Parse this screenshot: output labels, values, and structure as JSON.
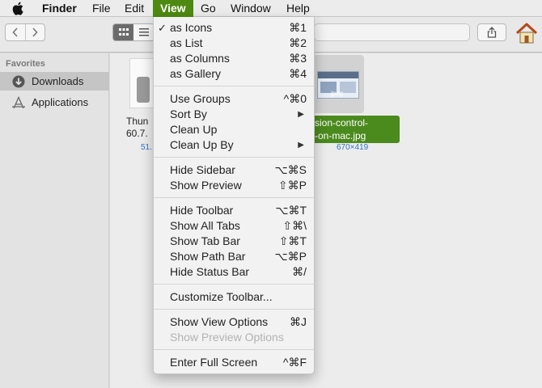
{
  "menubar": {
    "app": "Finder",
    "items": [
      "File",
      "Edit",
      "View",
      "Go",
      "Window",
      "Help"
    ]
  },
  "sidebar": {
    "heading": "Favorites",
    "items": [
      {
        "label": "Downloads",
        "icon": "downloads-icon",
        "selected": true
      },
      {
        "label": "Applications",
        "icon": "applications-icon",
        "selected": false
      }
    ]
  },
  "files": [
    {
      "name_line1": "Thun",
      "name_line2": "60.7.",
      "size": "51."
    },
    {
      "name_line1": "sion-control-",
      "name_line2": "-on-mac.jpg",
      "size": "670×419",
      "thumb_ext": "jpeg"
    }
  ],
  "view_menu": {
    "groups": [
      [
        {
          "label": "as Icons",
          "shortcut": "⌘1",
          "checked": true
        },
        {
          "label": "as List",
          "shortcut": "⌘2"
        },
        {
          "label": "as Columns",
          "shortcut": "⌘3"
        },
        {
          "label": "as Gallery",
          "shortcut": "⌘4"
        }
      ],
      [
        {
          "label": "Use Groups",
          "shortcut": "^⌘0"
        },
        {
          "label": "Sort By",
          "submenu": true
        },
        {
          "label": "Clean Up"
        },
        {
          "label": "Clean Up By",
          "submenu": true
        }
      ],
      [
        {
          "label": "Hide Sidebar",
          "shortcut": "⌥⌘S"
        },
        {
          "label": "Show Preview",
          "shortcut": "⇧⌘P"
        }
      ],
      [
        {
          "label": "Hide Toolbar",
          "shortcut": "⌥⌘T"
        },
        {
          "label": "Show All Tabs",
          "shortcut": "⇧⌘\\"
        },
        {
          "label": "Show Tab Bar",
          "shortcut": "⇧⌘T"
        },
        {
          "label": "Show Path Bar",
          "shortcut": "⌥⌘P"
        },
        {
          "label": "Hide Status Bar",
          "shortcut": "⌘/"
        }
      ],
      [
        {
          "label": "Customize Toolbar..."
        }
      ],
      [
        {
          "label": "Show View Options",
          "shortcut": "⌘J"
        },
        {
          "label": "Show Preview Options",
          "disabled": true
        }
      ],
      [
        {
          "label": "Enter Full Screen",
          "shortcut": "^⌘F"
        }
      ]
    ]
  },
  "colors": {
    "menu_highlight": "#4e8a12",
    "selection_green": "#4b8a1d",
    "link_blue": "#2f73c7"
  }
}
